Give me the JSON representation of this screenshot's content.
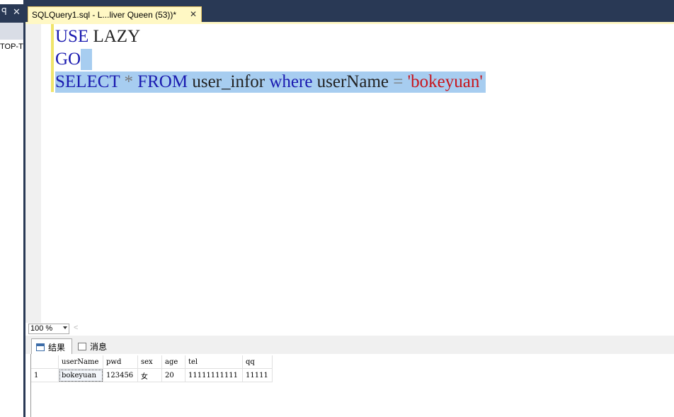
{
  "left_panel": {
    "pin_glyph": "ꟼ",
    "close_glyph": "✕",
    "server_text": "TOP-T"
  },
  "tab": {
    "title": "SQLQuery1.sql - L...liver Queen (53))*",
    "close_glyph": "✕"
  },
  "editor": {
    "line1": {
      "kw": "USE",
      "rest": " LAZY"
    },
    "line2": {
      "kw": "GO"
    },
    "line3": {
      "kw1": "SELECT",
      "sp1": " ",
      "op1": "*",
      "sp2": " ",
      "kw2": "FROM",
      "ident1": " user_infor ",
      "kw3": "where",
      "ident2": " userName ",
      "op2": "=",
      "sp3": " ",
      "str": "'bokeyuan'"
    }
  },
  "zoom": {
    "value": "100 %",
    "scroll_glyph": "<"
  },
  "result_tabs": {
    "results": "结果",
    "messages": "消息"
  },
  "grid": {
    "columns": [
      "userName",
      "pwd",
      "sex",
      "age",
      "tel",
      "qq"
    ],
    "rows": [
      {
        "num": "1",
        "cells": [
          "bokeyuan",
          "123456",
          "女",
          "20",
          "11111111111",
          "11111"
        ]
      }
    ]
  },
  "colors": {
    "keyword": "#1a1ab0",
    "string": "#c8141b",
    "selection": "#a7cdf0",
    "tab_active": "#fff8c4",
    "chrome": "#293955"
  }
}
